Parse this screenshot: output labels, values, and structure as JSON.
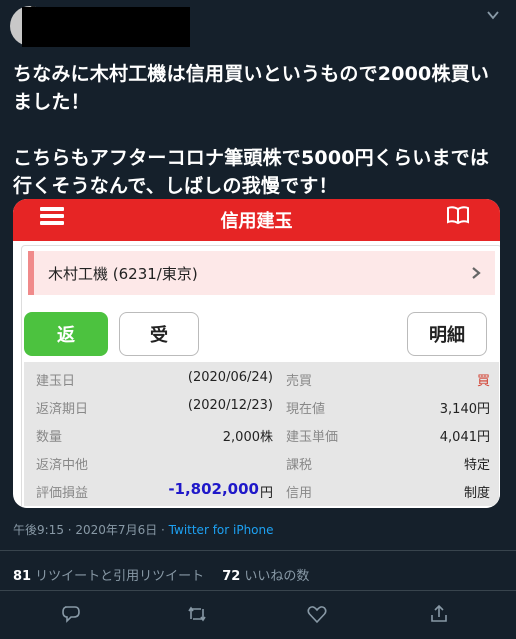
{
  "tweet": {
    "body_line1": "ちなみに木村工機は信用買いというもので2000株買いました！",
    "body_line2": "こちらもアフターコロナ筆頭株で5000円くらいまでは行くそうなんで、しばしの我慢です！",
    "timestamp": "午後9:15 · 2020年7月6日 · ",
    "source": "Twitter for iPhone",
    "retweets_count": "81",
    "retweets_label": "リツイートと引用リツイート",
    "likes_count": "72",
    "likes_label": "いいねの数"
  },
  "card": {
    "title": "信用建玉",
    "stock": "木村工機 (6231/東京)",
    "btn_back": "返",
    "btn_receive": "受",
    "btn_detail": "明細",
    "rows": [
      {
        "l1": "建玉日",
        "v1": "(2020/06/24)",
        "l2": "売買",
        "v2": "買"
      },
      {
        "l1": "返済期日",
        "v1": "(2020/12/23)",
        "l2": "現在値",
        "v2": "3,140円"
      },
      {
        "l1": "数量",
        "v1": "2,000株",
        "l2": "建玉単価",
        "v2": "4,041円"
      },
      {
        "l1": "返済中他",
        "v1": "",
        "l2": "課税",
        "v2": "特定"
      },
      {
        "l1": "評価損益",
        "v1": "-1,802,000",
        "v1_unit": "円",
        "l2": "信用",
        "v2": "制度"
      }
    ]
  },
  "colors": {
    "background": "#15202b",
    "card_header": "#e62525",
    "back_button": "#4cc23f",
    "loss_value": "#1f18c9",
    "buy_label": "#d23a2a",
    "link": "#1da1f2"
  }
}
